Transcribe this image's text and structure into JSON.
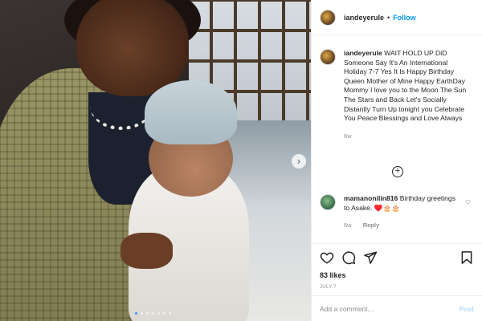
{
  "post": {
    "username": "iandeyerule",
    "separator": "•",
    "follow_label": "Follow",
    "caption_username": "iandeyerule",
    "caption_text": "WAIT HOLD UP DiD Someone Say It's An International Holiday 7-7 Yes It Is Happy Birthday Queen Mother of Mine Happy EarthDay Mommy I love you to the Moon The Sun The Stars and Back Let's Socially Distantly Turn Up tonight you Celebrate You Peace Blessings and Love Always",
    "caption_time": "6w",
    "load_more_symbol": "+",
    "comment": {
      "username": "mamanonilin816",
      "text": "Birthday greetings to Asake. ♥️🎂🎂",
      "time": "6w",
      "reply_label": "Reply",
      "like_icon": "heart-outline-icon"
    },
    "likes": "83 likes",
    "date": "JULY 7",
    "add_comment_placeholder": "Add a comment...",
    "post_label": "Post"
  },
  "media": {
    "next_icon": "chevron-right-icon",
    "next_symbol": "›",
    "carousel_count": 7,
    "carousel_active": 1
  },
  "colors": {
    "accent": "#0095f6",
    "post_disabled": "#b2dffc",
    "muted": "#8e8e8e",
    "text": "#262626"
  }
}
